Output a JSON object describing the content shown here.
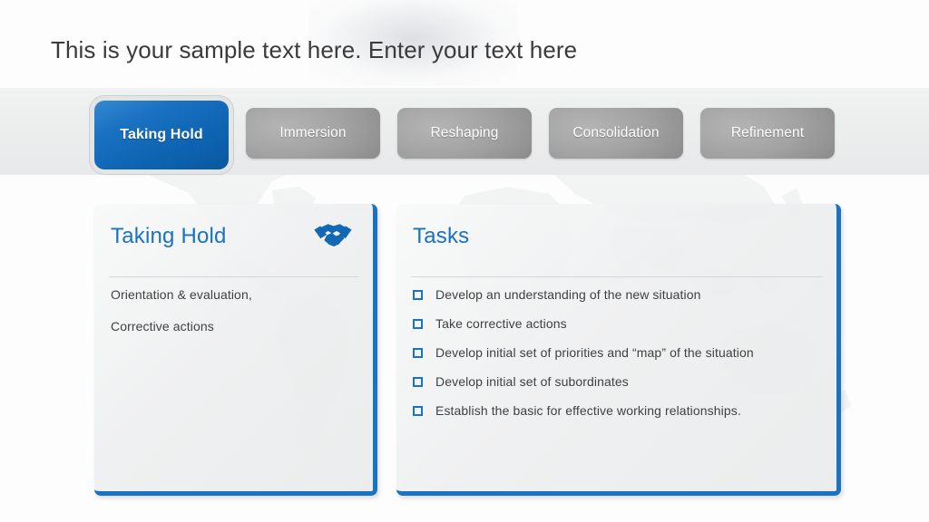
{
  "slide": {
    "title": "This is your sample text here. Enter your text here",
    "accent_color": "#1a72c2",
    "band_color": "#eceded",
    "inactive_tab_color": "#9a9a9a",
    "body_text_color": "#3f4142"
  },
  "tabs": [
    {
      "label": "Taking Hold",
      "active": true
    },
    {
      "label": "Immersion",
      "active": false
    },
    {
      "label": "Reshaping",
      "active": false
    },
    {
      "label": "Consolidation",
      "active": false
    },
    {
      "label": "Refinement",
      "active": false
    }
  ],
  "left_card": {
    "title": "Taking Hold",
    "icon": "handshake-icon",
    "lines": [
      "Orientation & evaluation,",
      "Corrective actions"
    ]
  },
  "right_card": {
    "title": "Tasks",
    "tasks": [
      "Develop an understanding of the new situation",
      "Take corrective actions",
      "Develop initial set of priorities and “map” of the situation",
      "Develop initial set of subordinates",
      "Establish the basic for effective working relationships."
    ]
  }
}
